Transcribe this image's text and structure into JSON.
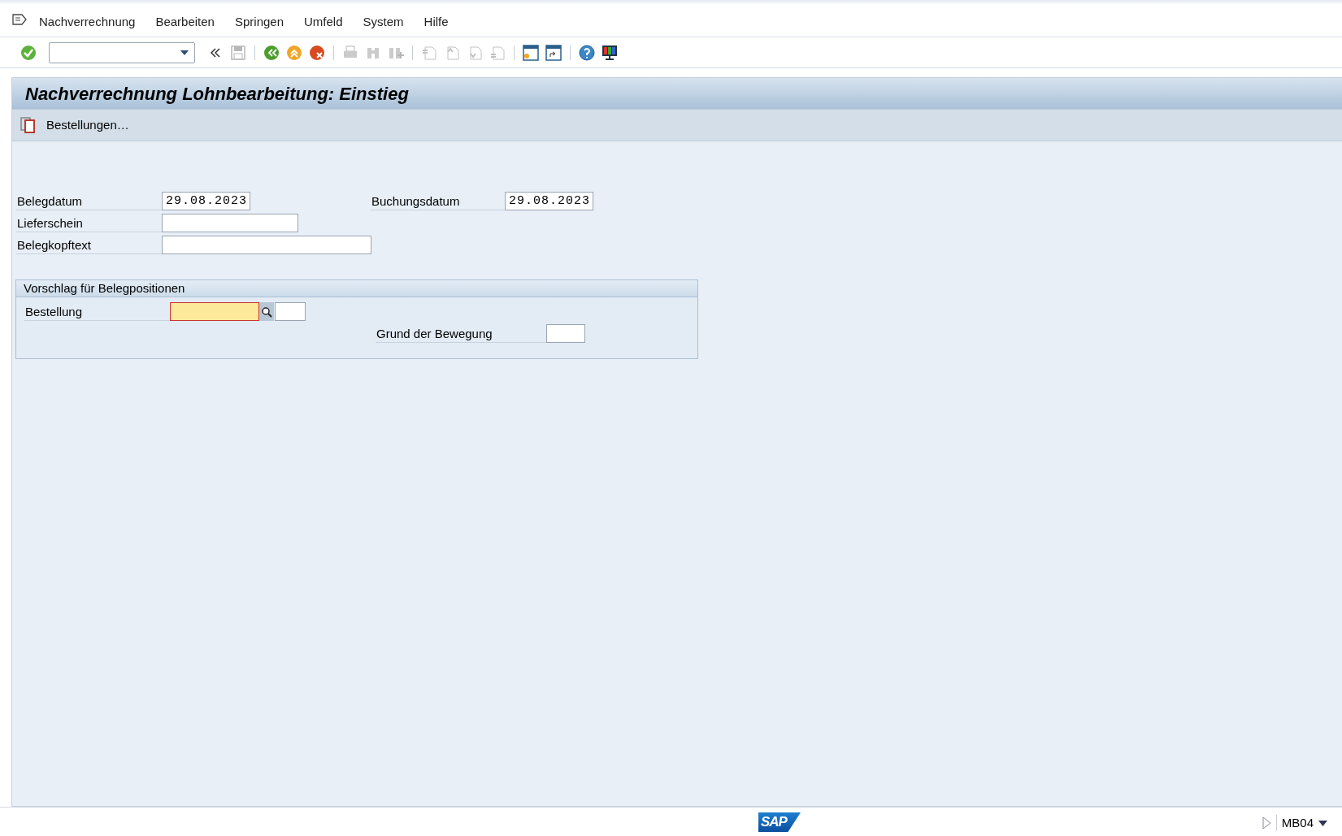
{
  "menu": [
    {
      "label": "Nachverrechnung"
    },
    {
      "label": "Bearbeiten"
    },
    {
      "label": "Springen"
    },
    {
      "label": "Umfeld"
    },
    {
      "label": "System"
    },
    {
      "label": "Hilfe"
    }
  ],
  "toolbar": [
    {
      "kind": "enter",
      "disabled": false
    },
    {
      "kind": "command",
      "disabled": false
    },
    {
      "kind": "collapse",
      "disabled": false
    },
    {
      "kind": "save",
      "disabled": true
    },
    {
      "kind": "sep"
    },
    {
      "kind": "back",
      "disabled": false
    },
    {
      "kind": "exit",
      "disabled": false
    },
    {
      "kind": "cancel",
      "disabled": false
    },
    {
      "kind": "sep"
    },
    {
      "kind": "print",
      "disabled": true
    },
    {
      "kind": "find",
      "disabled": true
    },
    {
      "kind": "findnext",
      "disabled": true
    },
    {
      "kind": "sep"
    },
    {
      "kind": "first",
      "disabled": true
    },
    {
      "kind": "prev",
      "disabled": true
    },
    {
      "kind": "next",
      "disabled": true
    },
    {
      "kind": "last",
      "disabled": true
    },
    {
      "kind": "sep"
    },
    {
      "kind": "session",
      "disabled": false
    },
    {
      "kind": "shortcut",
      "disabled": false
    },
    {
      "kind": "sep"
    },
    {
      "kind": "help",
      "disabled": false
    },
    {
      "kind": "layout",
      "disabled": false
    }
  ],
  "title": "Nachverrechnung Lohnbearbeitung: Einstieg",
  "actions": [
    {
      "label": "Bestellungen…"
    }
  ],
  "fields": [
    {
      "label": "Belegdatum",
      "value": "29.08.2023",
      "kind": "date"
    },
    {
      "label": "Buchungsdatum",
      "value": "29.08.2023",
      "kind": "date"
    },
    {
      "label": "Lieferschein",
      "kind": "medium"
    },
    {
      "label": "Belegkopftext",
      "kind": "long"
    }
  ],
  "group": {
    "title": "Vorschlag für Belegpositionen",
    "fields": [
      {
        "label": "Bestellung",
        "kind": "order",
        "focused": true
      },
      {
        "label": "Grund der Bewegung",
        "kind": "short",
        "focused": false
      }
    ]
  },
  "status_bar": {
    "logo": "SAP",
    "transaction": "MB04"
  }
}
